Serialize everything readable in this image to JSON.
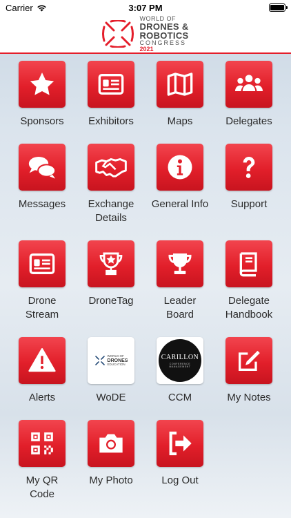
{
  "status_bar": {
    "carrier": "Carrier",
    "time": "3:07 PM"
  },
  "header": {
    "logo_line1": "WORLD OF",
    "logo_line2": "DRONES &",
    "logo_line3": "ROBOTICS",
    "logo_line4": "CONGRESS",
    "logo_line5": "2021"
  },
  "tiles": [
    {
      "label": "Sponsors",
      "icon": "star-icon"
    },
    {
      "label": "Exhibitors",
      "icon": "id-card-icon"
    },
    {
      "label": "Maps",
      "icon": "map-icon"
    },
    {
      "label": "Delegates",
      "icon": "users-icon"
    },
    {
      "label": "Messages",
      "icon": "chat-bubbles-icon"
    },
    {
      "label": "Exchange Details",
      "icon": "handshake-icon"
    },
    {
      "label": "General Info",
      "icon": "info-icon"
    },
    {
      "label": "Support",
      "icon": "question-icon"
    },
    {
      "label": "Drone Stream",
      "icon": "id-card-icon"
    },
    {
      "label": "DroneTag",
      "icon": "trophy-star-icon"
    },
    {
      "label": "Leader Board",
      "icon": "trophy-icon"
    },
    {
      "label": "Delegate Handbook",
      "icon": "book-icon"
    },
    {
      "label": "Alerts",
      "icon": "warning-icon"
    },
    {
      "label": "WoDE",
      "icon": "wode-logo",
      "logo_text_1": "WORLD OF",
      "logo_text_2": "DRONES",
      "logo_text_3": "EDUCATION"
    },
    {
      "label": "CCM",
      "icon": "carillon-logo",
      "logo_text_1": "CARILLON",
      "logo_text_2": "CONFERENCE",
      "logo_text_3": "MANAGEMENT"
    },
    {
      "label": "My Notes",
      "icon": "edit-icon"
    },
    {
      "label": "My QR Code",
      "icon": "qr-code-icon"
    },
    {
      "label": "My Photo",
      "icon": "camera-icon"
    },
    {
      "label": "Log Out",
      "icon": "logout-icon"
    }
  ],
  "colors": {
    "accent": "#e41e2b",
    "label_text": "#2b2b2b"
  }
}
